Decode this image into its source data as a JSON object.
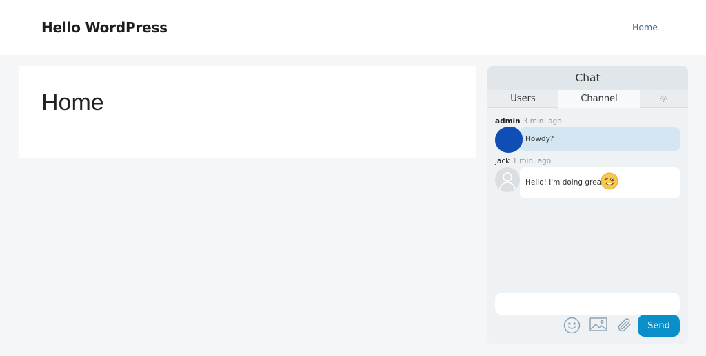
{
  "site": {
    "title": "Hello WordPress"
  },
  "nav": {
    "items": [
      {
        "label": "Home"
      }
    ]
  },
  "page": {
    "title": "Home"
  },
  "chat": {
    "header": "Chat",
    "tabs": [
      {
        "label": "Users"
      },
      {
        "label": "Channel"
      },
      {
        "label": "",
        "icon": "gear-icon"
      }
    ],
    "active_tab": "Channel",
    "messages": [
      {
        "author": "admin",
        "time": "3 min. ago",
        "text": "Howdy?",
        "bubble_color": "#d4e6f1",
        "avatar_color": "#0f4eb4"
      },
      {
        "author": "jack",
        "time": "1 min. ago",
        "text": "Hello! I'm doing great.",
        "bubble_color": "#ffffff",
        "emoji": "winking-face-emoji"
      }
    ],
    "input": {
      "value": "",
      "placeholder": ""
    },
    "toolbar": {
      "icons": [
        "smiley-icon",
        "image-icon",
        "paperclip-icon"
      ],
      "send_label": "Send",
      "send_color": "#0a8fc9"
    }
  },
  "colors": {
    "link": "#3e6f9e",
    "background": "#f4f6f8"
  }
}
